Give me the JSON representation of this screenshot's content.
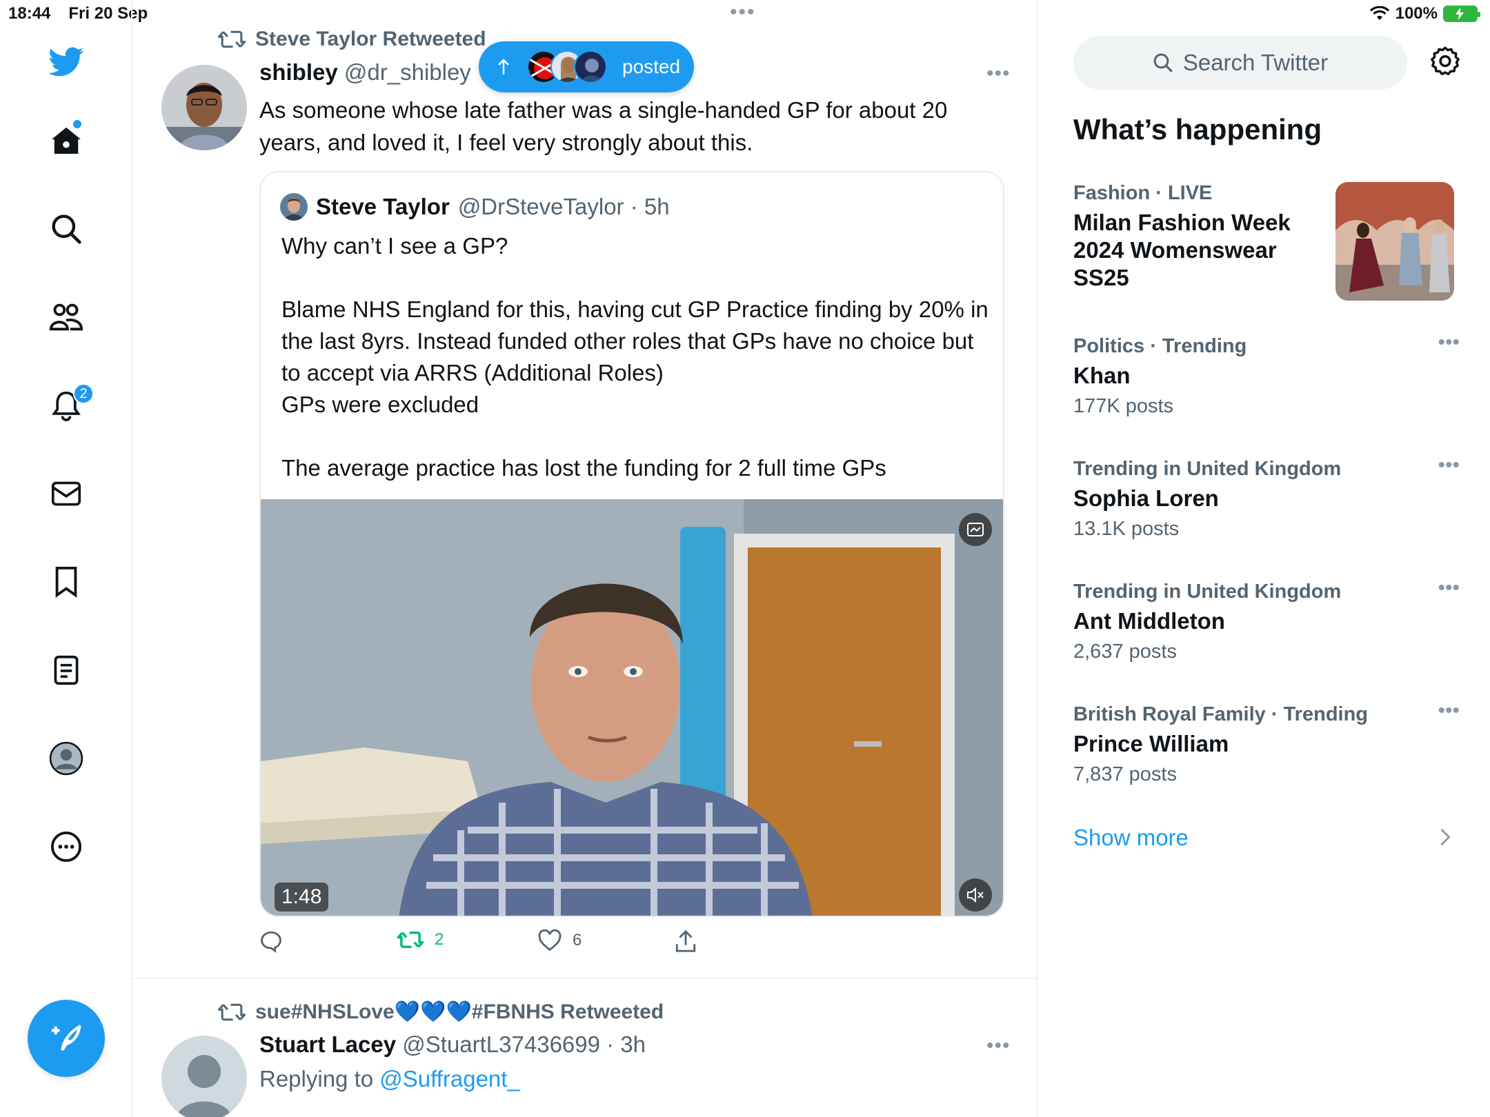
{
  "status_bar": {
    "time": "18:44",
    "date": "Fri 20 Sep",
    "battery": "100%"
  },
  "sidebar": {
    "notifications_badge": "2",
    "icons": [
      "twitter-bird-icon",
      "home-icon",
      "search-icon",
      "communities-icon",
      "bell-icon",
      "mail-icon",
      "bookmark-icon",
      "lists-icon",
      "profile-icon",
      "more-icon",
      "compose-icon"
    ]
  },
  "posted_pill": {
    "label": "posted"
  },
  "tweet1": {
    "retweeted_by": "Steve Taylor Retweeted",
    "name": "shibley",
    "handle": "@dr_shibley ·",
    "text": "As someone whose late father was a single-handed GP for about 20 years, and loved it, I feel very strongly about this.",
    "quote": {
      "name": "Steve Taylor",
      "handle": "@DrSteveTaylor · 5h",
      "text": "Why can’t I see a GP?\n\nBlame NHS England for this, having cut GP Practice finding by 20% in the last 8yrs. Instead funded other roles that GPs have no choice but to accept via ARRS (Additional Roles)\nGPs were excluded\n\nThe average practice has lost the funding for 2 full time GPs",
      "video_duration": "1:48"
    },
    "retweets": "2",
    "likes": "6"
  },
  "tweet2": {
    "retweeted_by": "sue#NHSLove💙💙💙#FBNHS Retweeted",
    "name": "Stuart Lacey",
    "handle": "@StuartL37436699 · 3h",
    "replying_prefix": "Replying to ",
    "replying_to": "@Suffragent_"
  },
  "right": {
    "search_placeholder": "Search Twitter",
    "section_title": "What’s happening",
    "trends": [
      {
        "context": "Fashion · LIVE",
        "name": "Milan Fashion Week 2024 Womenswear SS25",
        "count": ""
      },
      {
        "context": "Politics · Trending",
        "name": "Khan",
        "count": "177K posts"
      },
      {
        "context": "Trending in United Kingdom",
        "name": "Sophia Loren",
        "count": "13.1K posts"
      },
      {
        "context": "Trending in United Kingdom",
        "name": "Ant Middleton",
        "count": "2,637 posts"
      },
      {
        "context": "British Royal Family · Trending",
        "name": "Prince William",
        "count": "7,837 posts"
      }
    ],
    "show_more": "Show more"
  },
  "colors": {
    "accent": "#1d9bf0",
    "retweet_green": "#00ba7c",
    "muted": "#536471"
  }
}
